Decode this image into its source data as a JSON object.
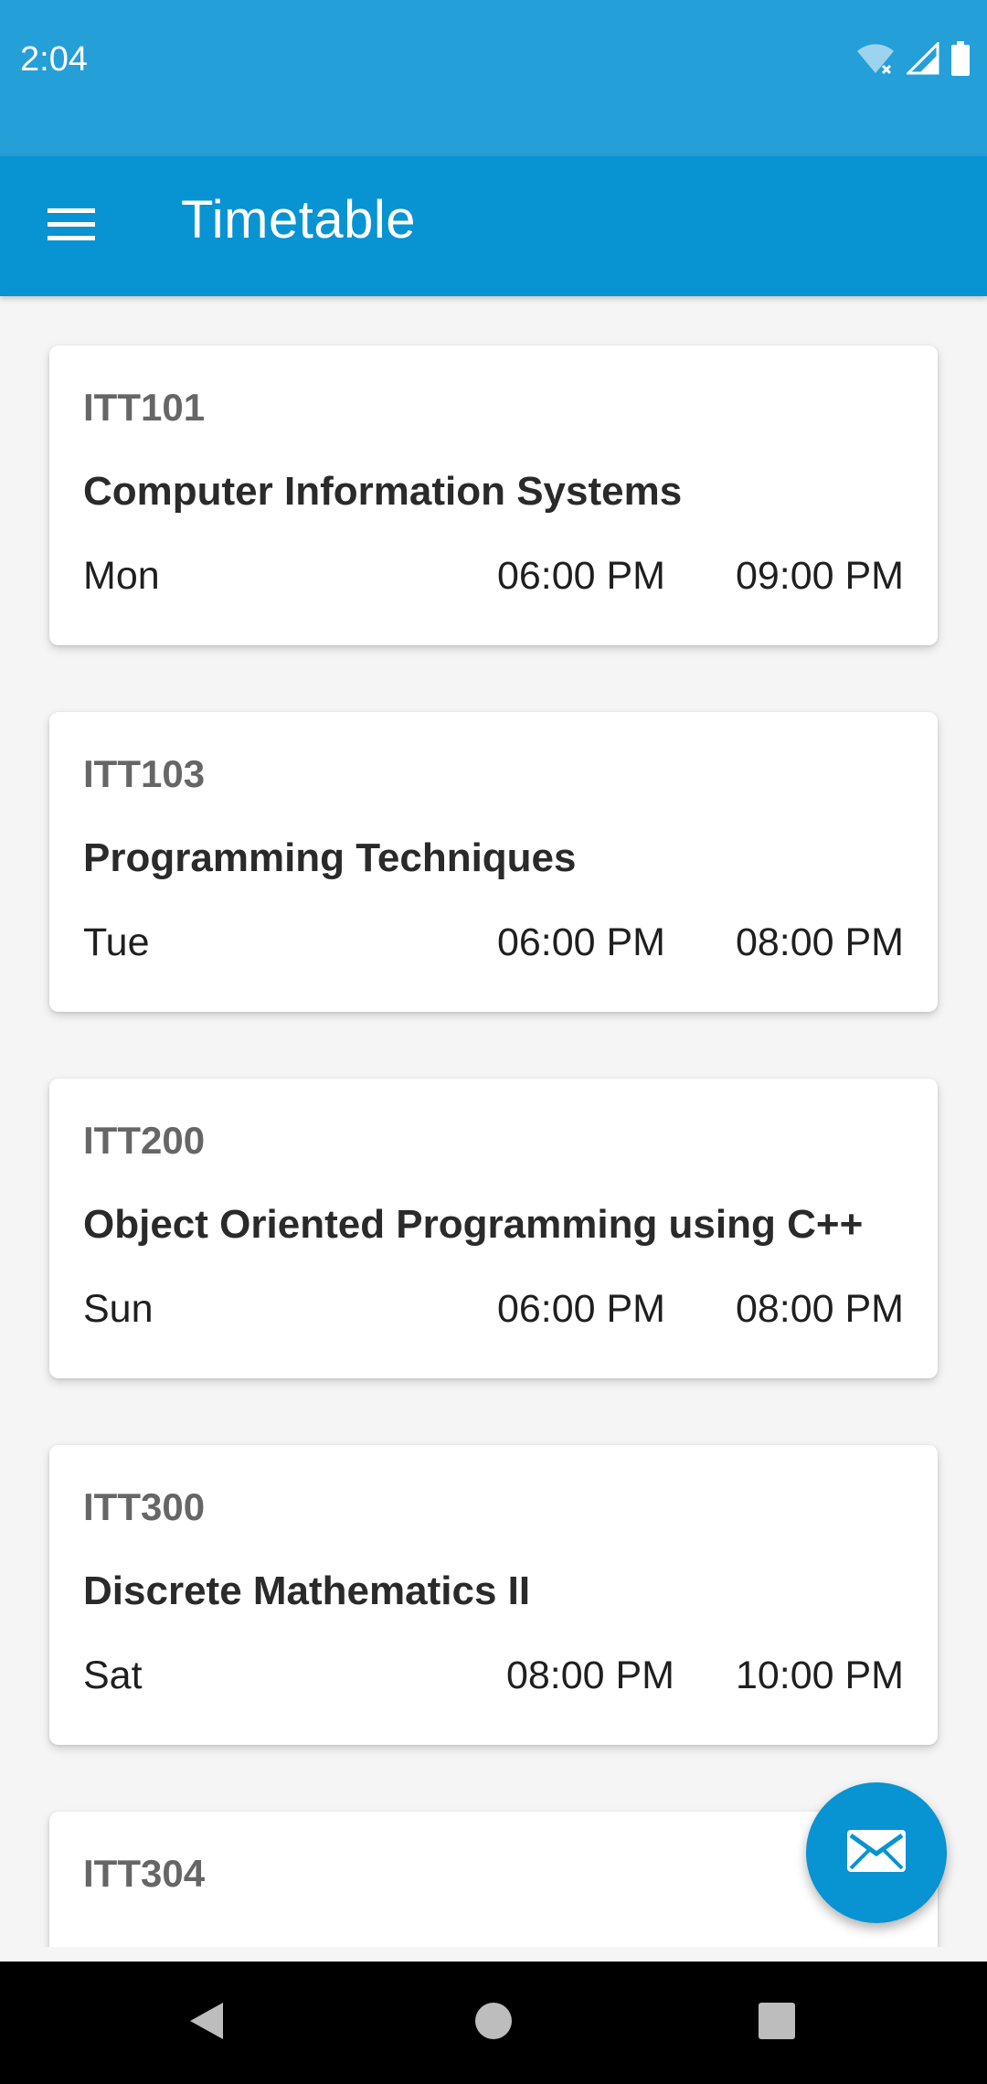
{
  "status_bar": {
    "time": "2:04",
    "icons": [
      "wifi-icon",
      "cell-signal-icon",
      "battery-icon"
    ]
  },
  "app_bar": {
    "title": "Timetable",
    "menu_icon": "hamburger-menu-icon",
    "background": "#0893d2"
  },
  "courses": [
    {
      "code": "ITT101",
      "name": "Computer Information Systems",
      "day": "Mon",
      "start": "06:00 PM",
      "end": "09:00 PM"
    },
    {
      "code": "ITT103",
      "name": "Programming Techniques",
      "day": "Tue",
      "start": "06:00 PM",
      "end": "08:00 PM"
    },
    {
      "code": "ITT200",
      "name": "Object Oriented Programming using C++",
      "day": "Sun",
      "start": "06:00 PM",
      "end": "08:00 PM"
    },
    {
      "code": "ITT300",
      "name": "Discrete Mathematics II",
      "day": "Sat",
      "start": "08:00 PM",
      "end": "10:00 PM"
    },
    {
      "code": "ITT304",
      "name": "",
      "day": "",
      "start": "",
      "end": ""
    }
  ],
  "fab": {
    "icon": "mail-icon"
  },
  "nav_bar": {
    "icons": [
      "back-icon",
      "home-icon",
      "recents-icon"
    ]
  }
}
